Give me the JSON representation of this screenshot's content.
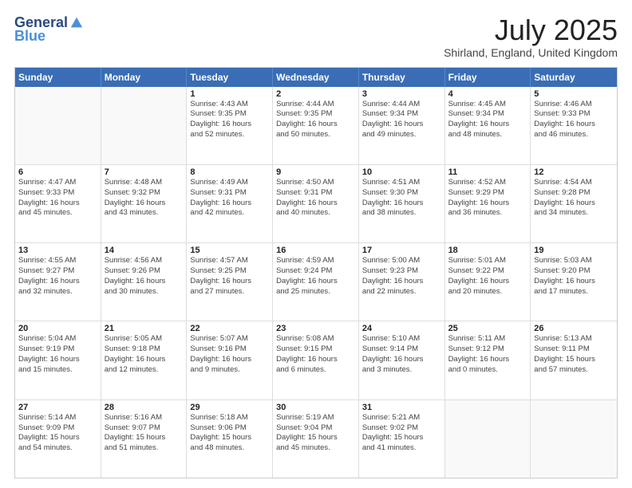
{
  "logo": {
    "general": "General",
    "blue": "Blue"
  },
  "title": "July 2025",
  "location": "Shirland, England, United Kingdom",
  "weekdays": [
    "Sunday",
    "Monday",
    "Tuesday",
    "Wednesday",
    "Thursday",
    "Friday",
    "Saturday"
  ],
  "weeks": [
    [
      {
        "day": "",
        "lines": []
      },
      {
        "day": "",
        "lines": []
      },
      {
        "day": "1",
        "lines": [
          "Sunrise: 4:43 AM",
          "Sunset: 9:35 PM",
          "Daylight: 16 hours",
          "and 52 minutes."
        ]
      },
      {
        "day": "2",
        "lines": [
          "Sunrise: 4:44 AM",
          "Sunset: 9:35 PM",
          "Daylight: 16 hours",
          "and 50 minutes."
        ]
      },
      {
        "day": "3",
        "lines": [
          "Sunrise: 4:44 AM",
          "Sunset: 9:34 PM",
          "Daylight: 16 hours",
          "and 49 minutes."
        ]
      },
      {
        "day": "4",
        "lines": [
          "Sunrise: 4:45 AM",
          "Sunset: 9:34 PM",
          "Daylight: 16 hours",
          "and 48 minutes."
        ]
      },
      {
        "day": "5",
        "lines": [
          "Sunrise: 4:46 AM",
          "Sunset: 9:33 PM",
          "Daylight: 16 hours",
          "and 46 minutes."
        ]
      }
    ],
    [
      {
        "day": "6",
        "lines": [
          "Sunrise: 4:47 AM",
          "Sunset: 9:33 PM",
          "Daylight: 16 hours",
          "and 45 minutes."
        ]
      },
      {
        "day": "7",
        "lines": [
          "Sunrise: 4:48 AM",
          "Sunset: 9:32 PM",
          "Daylight: 16 hours",
          "and 43 minutes."
        ]
      },
      {
        "day": "8",
        "lines": [
          "Sunrise: 4:49 AM",
          "Sunset: 9:31 PM",
          "Daylight: 16 hours",
          "and 42 minutes."
        ]
      },
      {
        "day": "9",
        "lines": [
          "Sunrise: 4:50 AM",
          "Sunset: 9:31 PM",
          "Daylight: 16 hours",
          "and 40 minutes."
        ]
      },
      {
        "day": "10",
        "lines": [
          "Sunrise: 4:51 AM",
          "Sunset: 9:30 PM",
          "Daylight: 16 hours",
          "and 38 minutes."
        ]
      },
      {
        "day": "11",
        "lines": [
          "Sunrise: 4:52 AM",
          "Sunset: 9:29 PM",
          "Daylight: 16 hours",
          "and 36 minutes."
        ]
      },
      {
        "day": "12",
        "lines": [
          "Sunrise: 4:54 AM",
          "Sunset: 9:28 PM",
          "Daylight: 16 hours",
          "and 34 minutes."
        ]
      }
    ],
    [
      {
        "day": "13",
        "lines": [
          "Sunrise: 4:55 AM",
          "Sunset: 9:27 PM",
          "Daylight: 16 hours",
          "and 32 minutes."
        ]
      },
      {
        "day": "14",
        "lines": [
          "Sunrise: 4:56 AM",
          "Sunset: 9:26 PM",
          "Daylight: 16 hours",
          "and 30 minutes."
        ]
      },
      {
        "day": "15",
        "lines": [
          "Sunrise: 4:57 AM",
          "Sunset: 9:25 PM",
          "Daylight: 16 hours",
          "and 27 minutes."
        ]
      },
      {
        "day": "16",
        "lines": [
          "Sunrise: 4:59 AM",
          "Sunset: 9:24 PM",
          "Daylight: 16 hours",
          "and 25 minutes."
        ]
      },
      {
        "day": "17",
        "lines": [
          "Sunrise: 5:00 AM",
          "Sunset: 9:23 PM",
          "Daylight: 16 hours",
          "and 22 minutes."
        ]
      },
      {
        "day": "18",
        "lines": [
          "Sunrise: 5:01 AM",
          "Sunset: 9:22 PM",
          "Daylight: 16 hours",
          "and 20 minutes."
        ]
      },
      {
        "day": "19",
        "lines": [
          "Sunrise: 5:03 AM",
          "Sunset: 9:20 PM",
          "Daylight: 16 hours",
          "and 17 minutes."
        ]
      }
    ],
    [
      {
        "day": "20",
        "lines": [
          "Sunrise: 5:04 AM",
          "Sunset: 9:19 PM",
          "Daylight: 16 hours",
          "and 15 minutes."
        ]
      },
      {
        "day": "21",
        "lines": [
          "Sunrise: 5:05 AM",
          "Sunset: 9:18 PM",
          "Daylight: 16 hours",
          "and 12 minutes."
        ]
      },
      {
        "day": "22",
        "lines": [
          "Sunrise: 5:07 AM",
          "Sunset: 9:16 PM",
          "Daylight: 16 hours",
          "and 9 minutes."
        ]
      },
      {
        "day": "23",
        "lines": [
          "Sunrise: 5:08 AM",
          "Sunset: 9:15 PM",
          "Daylight: 16 hours",
          "and 6 minutes."
        ]
      },
      {
        "day": "24",
        "lines": [
          "Sunrise: 5:10 AM",
          "Sunset: 9:14 PM",
          "Daylight: 16 hours",
          "and 3 minutes."
        ]
      },
      {
        "day": "25",
        "lines": [
          "Sunrise: 5:11 AM",
          "Sunset: 9:12 PM",
          "Daylight: 16 hours",
          "and 0 minutes."
        ]
      },
      {
        "day": "26",
        "lines": [
          "Sunrise: 5:13 AM",
          "Sunset: 9:11 PM",
          "Daylight: 15 hours",
          "and 57 minutes."
        ]
      }
    ],
    [
      {
        "day": "27",
        "lines": [
          "Sunrise: 5:14 AM",
          "Sunset: 9:09 PM",
          "Daylight: 15 hours",
          "and 54 minutes."
        ]
      },
      {
        "day": "28",
        "lines": [
          "Sunrise: 5:16 AM",
          "Sunset: 9:07 PM",
          "Daylight: 15 hours",
          "and 51 minutes."
        ]
      },
      {
        "day": "29",
        "lines": [
          "Sunrise: 5:18 AM",
          "Sunset: 9:06 PM",
          "Daylight: 15 hours",
          "and 48 minutes."
        ]
      },
      {
        "day": "30",
        "lines": [
          "Sunrise: 5:19 AM",
          "Sunset: 9:04 PM",
          "Daylight: 15 hours",
          "and 45 minutes."
        ]
      },
      {
        "day": "31",
        "lines": [
          "Sunrise: 5:21 AM",
          "Sunset: 9:02 PM",
          "Daylight: 15 hours",
          "and 41 minutes."
        ]
      },
      {
        "day": "",
        "lines": []
      },
      {
        "day": "",
        "lines": []
      }
    ]
  ]
}
